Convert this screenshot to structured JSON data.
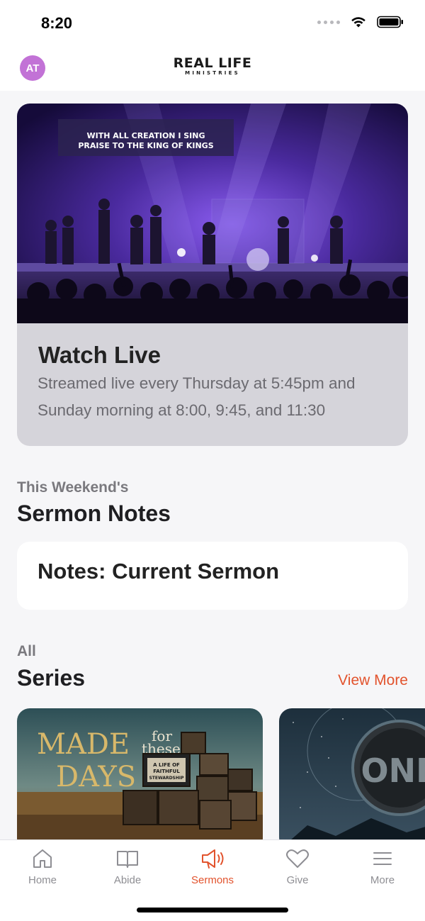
{
  "status_bar": {
    "time": "8:20"
  },
  "header": {
    "avatar_initials": "AT",
    "logo_main": "REAL LIFE",
    "logo_sub": "MINISTRIES"
  },
  "live": {
    "banner_line1": "WITH ALL CREATION I SING",
    "banner_line2": "PRAISE TO THE KING OF KINGS",
    "title": "Watch Live",
    "description": "Streamed live every Thursday at 5:45pm and Sunday morning at 8:00, 9:45, and 11:30"
  },
  "sermon_notes": {
    "eyebrow": "This Weekend's",
    "title": "Sermon Notes",
    "card_label": "Notes: Current Sermon"
  },
  "series": {
    "eyebrow": "All",
    "title": "Series",
    "view_more": "View More",
    "items": [
      {
        "title_line1": "MADE",
        "title_line2": "DAYS",
        "script_line1": "for",
        "script_line2": "these",
        "tv_line1": "A LIFE OF",
        "tv_line2": "FAITHFUL",
        "tv_line3": "STEWARDSHIP"
      },
      {
        "title": "ONE"
      }
    ]
  },
  "tabs": [
    {
      "label": "Home",
      "icon": "home-icon",
      "active": false
    },
    {
      "label": "Abide",
      "icon": "book-icon",
      "active": false
    },
    {
      "label": "Sermons",
      "icon": "megaphone-icon",
      "active": true
    },
    {
      "label": "Give",
      "icon": "heart-icon",
      "active": false
    },
    {
      "label": "More",
      "icon": "menu-icon",
      "active": false
    }
  ],
  "colors": {
    "accent": "#e2532d",
    "avatar": "#c272d6",
    "background": "#f6f6f8"
  }
}
